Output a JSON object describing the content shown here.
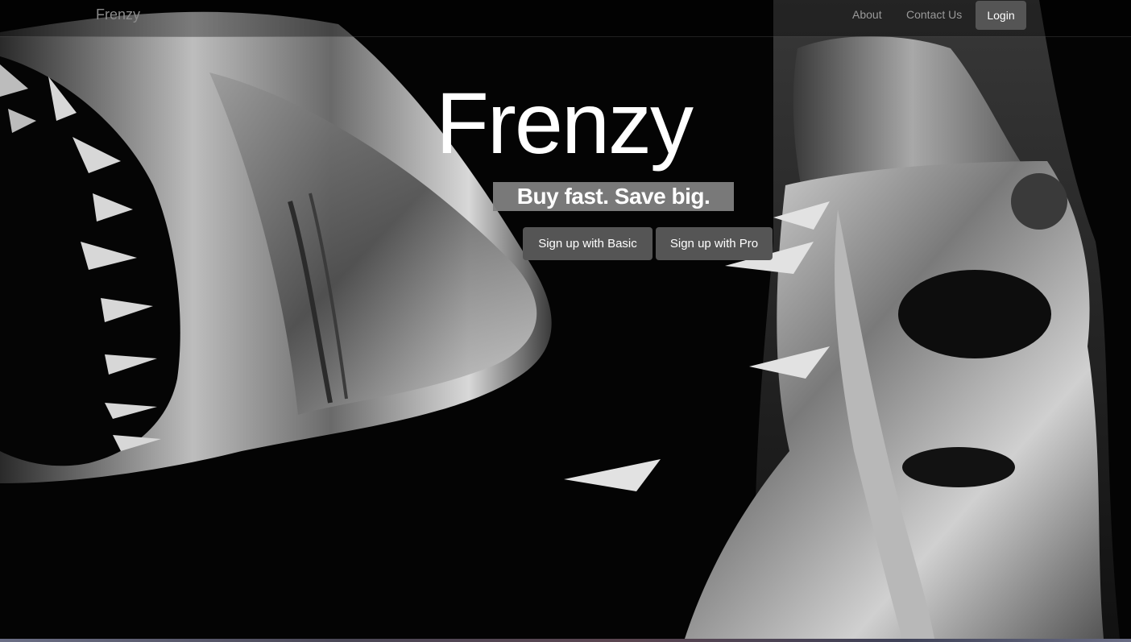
{
  "nav": {
    "brand": "Frenzy",
    "links": [
      "About",
      "Contact Us"
    ],
    "login_label": "Login"
  },
  "hero": {
    "title": "Frenzy",
    "tagline": "Buy fast. Save big.",
    "buttons": [
      "Sign up with Basic",
      "Sign up with Pro"
    ]
  },
  "images": {
    "left": "shark-photo",
    "right": "fashion-model-photo"
  },
  "colors": {
    "background": "#040404",
    "button": "#555555",
    "tagline_bg": "#808080",
    "text": "#ffffff",
    "nav_text": "#9a9a9a"
  }
}
